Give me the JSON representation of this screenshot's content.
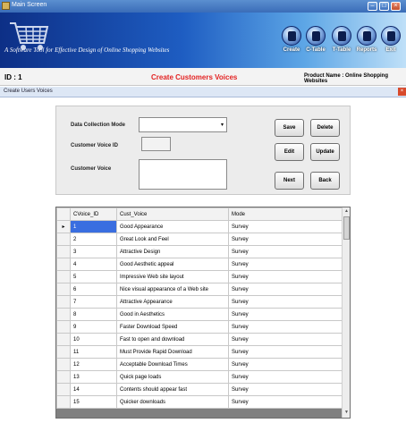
{
  "window": {
    "title": "Main Screen",
    "min": "–",
    "max": "□",
    "close": "×"
  },
  "banner": {
    "tagline": "A Software Tool for Effective Design of Online Shopping Websites"
  },
  "toolbar": [
    {
      "label": "Create",
      "icon": "create-icon"
    },
    {
      "label": "C-Table",
      "icon": "c-table-icon"
    },
    {
      "label": "T-Table",
      "icon": "t-table-icon"
    },
    {
      "label": "Reports",
      "icon": "reports-icon"
    },
    {
      "label": "Exit",
      "icon": "exit-icon"
    }
  ],
  "info": {
    "id": "ID : 1",
    "title": "Create Customers Voices",
    "product": "Product Name :  Online Shopping Websites"
  },
  "child": {
    "title": "Create Users Voices",
    "close": "×"
  },
  "form": {
    "mode_label": "Data Collection Mode",
    "mode_value": "",
    "id_label": "Customer Voice ID",
    "id_value": "",
    "voice_label": "Customer Voice",
    "voice_value": "",
    "buttons": {
      "save": "Save",
      "delete": "Delete",
      "edit": "Edit",
      "update": "Update",
      "next": "Next",
      "back": "Back"
    }
  },
  "grid": {
    "columns": [
      "CVoice_ID",
      "Cust_Voice",
      "Mode"
    ],
    "current_row_marker": "▸",
    "rows": [
      [
        "1",
        "Good Appearance",
        "Survey"
      ],
      [
        "2",
        "Great Look and Feel",
        "Survey"
      ],
      [
        "3",
        "Attractive Design",
        "Survey"
      ],
      [
        "4",
        "Good Aesthetic appeal",
        "Survey"
      ],
      [
        "5",
        "Impressive Web site layout",
        "Survey"
      ],
      [
        "6",
        "Nice visual appearance of a Web site",
        "Survey"
      ],
      [
        "7",
        "Attractive Appearance",
        "Survey"
      ],
      [
        "8",
        "Good in Aesthetics",
        "Survey"
      ],
      [
        "9",
        "Faster Download Speed",
        "Survey"
      ],
      [
        "10",
        "Fast to open and download",
        "Survey"
      ],
      [
        "11",
        "Must Provide Rapid Download",
        "Survey"
      ],
      [
        "12",
        "Acceptable Download Times",
        "Survey"
      ],
      [
        "13",
        "Quick page loads",
        "Survey"
      ],
      [
        "14",
        "Contents should appear fast",
        "Survey"
      ],
      [
        "15",
        "Quicker downloads",
        "Survey"
      ]
    ]
  },
  "colors": {
    "title_red": "#e32222",
    "banner_dark": "#0d2f86",
    "selection": "#3a6ee0"
  }
}
